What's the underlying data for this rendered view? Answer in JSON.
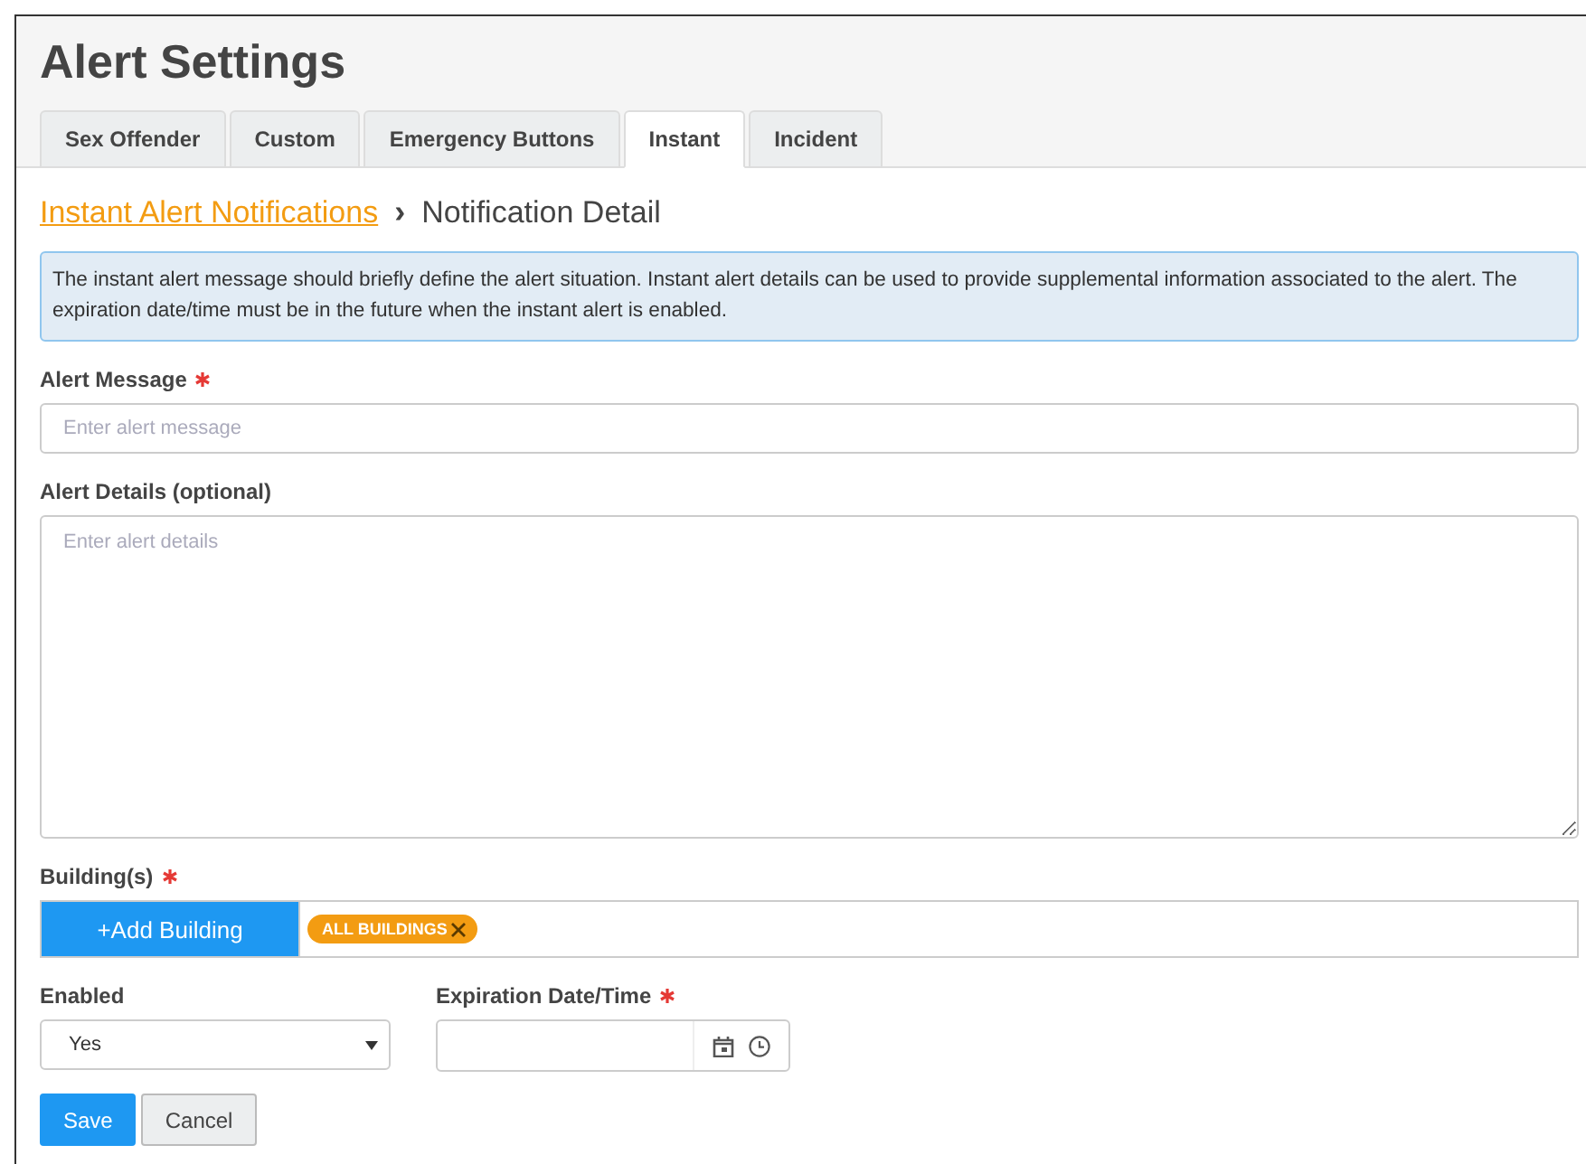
{
  "page": {
    "title": "Alert Settings"
  },
  "tabs": [
    {
      "label": "Sex Offender",
      "selected": false
    },
    {
      "label": "Custom",
      "selected": false
    },
    {
      "label": "Emergency Buttons",
      "selected": false
    },
    {
      "label": "Instant",
      "selected": true
    },
    {
      "label": "Incident",
      "selected": false
    }
  ],
  "breadcrumb": {
    "link": "Instant Alert Notifications",
    "separator": "›",
    "current": "Notification Detail"
  },
  "info": "The instant alert message should briefly define the alert situation. Instant alert details can be used to provide supplemental information associated to the alert. The expiration date/time must be in the future when the instant alert is enabled.",
  "alert_message": {
    "label": "Alert Message",
    "required": true,
    "placeholder": "Enter alert message"
  },
  "alert_details": {
    "label": "Alert Details (optional)",
    "required": false,
    "placeholder": "Enter alert details"
  },
  "buildings": {
    "label": "Building(s)",
    "required": true,
    "add_button": "+Add Building",
    "tags": [
      "ALL BUILDINGS"
    ]
  },
  "enabled": {
    "label": "Enabled",
    "required": false,
    "value": "Yes"
  },
  "expiration": {
    "label": "Expiration Date/Time",
    "required": true
  },
  "buttons": [
    {
      "label": "Save",
      "kind": "primary"
    },
    {
      "label": "Cancel",
      "kind": "secondary"
    }
  ]
}
